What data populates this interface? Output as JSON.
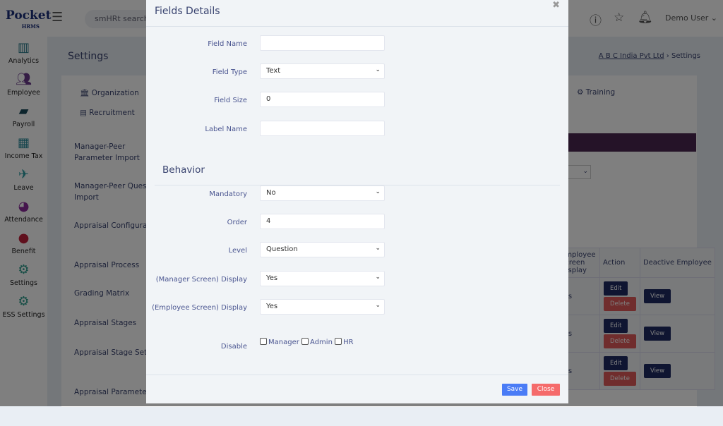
{
  "header": {
    "logo": "Pocket",
    "logo_sub": "HRMS",
    "search_placeholder": "smHRt searchHR",
    "user": "Demo User ⌄"
  },
  "sidebar": {
    "items": [
      {
        "label": "Analytics"
      },
      {
        "label": "Employee"
      },
      {
        "label": "Payroll"
      },
      {
        "label": "Income Tax"
      },
      {
        "label": "Leave"
      },
      {
        "label": "Attendance"
      },
      {
        "label": "Benefit"
      },
      {
        "label": "Settings"
      },
      {
        "label": "ESS Settings"
      }
    ]
  },
  "page": {
    "title": "Settings",
    "breadcrumb_company": "A B C India Pvt Ltd",
    "breadcrumb_current": "Settings",
    "tabs": [
      "Organization",
      "Recruitment",
      "Training"
    ],
    "menu": [
      "Manager-Peer Parameter Import",
      "Manager-Peer Question Import",
      "Appraisal Configuration",
      "Appraisal Process",
      "Grading Matrix",
      "Appraisal Stages",
      "Appraisal Stage Settings",
      "Appraisal Parameters"
    ],
    "table": {
      "headers": [
        "Employee Screen Display",
        "Action",
        "Deactive Employee"
      ],
      "rows": [
        {
          "display": "Yes"
        },
        {
          "display": "Yes"
        },
        {
          "display": "Yes"
        }
      ],
      "edit": "Edit",
      "delete": "Delete",
      "view": "View"
    }
  },
  "modal": {
    "title": "Fields Details",
    "close_icon": "✖",
    "fields": {
      "field_name": {
        "label": "Field Name",
        "value": ""
      },
      "field_type": {
        "label": "Field Type",
        "value": "Text"
      },
      "field_size": {
        "label": "Field Size",
        "value": "0"
      },
      "label_name": {
        "label": "Label Name",
        "value": ""
      }
    },
    "behavior_title": "Behavior",
    "behavior": {
      "mandatory": {
        "label": "Mandatory",
        "value": "No"
      },
      "order": {
        "label": "Order",
        "value": "4"
      },
      "level": {
        "label": "Level",
        "value": "Question"
      },
      "manager_display": {
        "label": "(Manager Screen) Display",
        "value": "Yes"
      },
      "employee_display": {
        "label": "(Employee Screen) Display",
        "value": "Yes"
      },
      "disable": {
        "label": "Disable",
        "options": [
          "Manager",
          "Admin",
          "HR"
        ]
      }
    },
    "save": "Save",
    "close": "Close"
  },
  "colors": {
    "save": "#4a7cf6",
    "close": "#f56b6b",
    "navy": "#1e2a63",
    "band": "#4a2651"
  }
}
